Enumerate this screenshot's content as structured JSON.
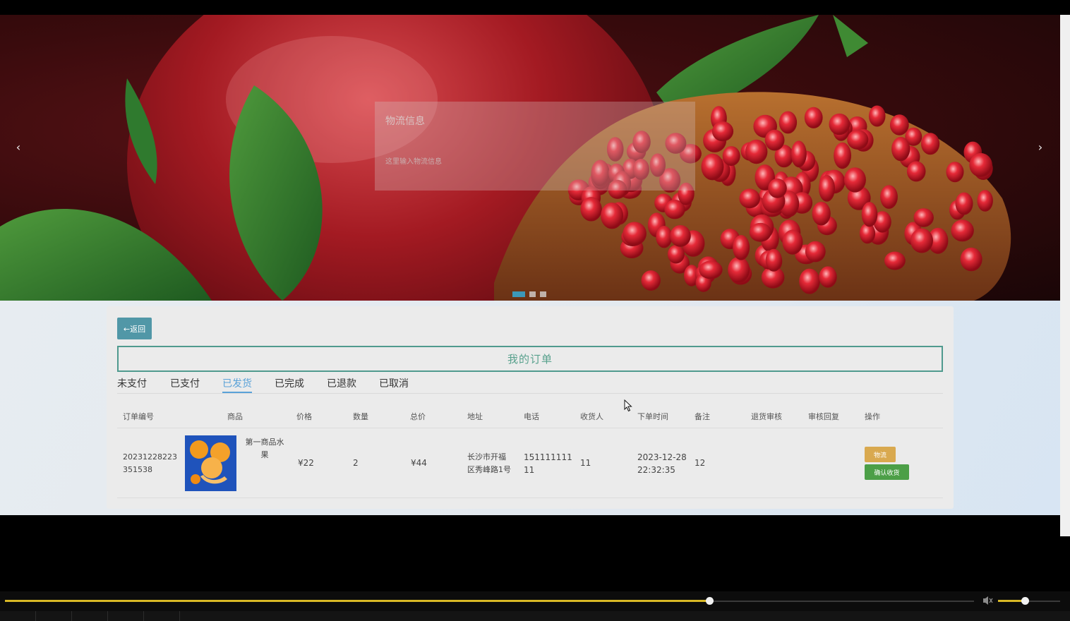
{
  "banner": {
    "prev_arrow": "‹",
    "next_arrow": "›",
    "slides": 3,
    "active_slide": 1,
    "logistics_title": "物流信息",
    "logistics_placeholder": "这里输入物流信息"
  },
  "main": {
    "back_label": "←返回",
    "page_title": "我的订单",
    "tabs": [
      {
        "label": "未支付"
      },
      {
        "label": "已支付"
      },
      {
        "label": "已发货"
      },
      {
        "label": "已完成"
      },
      {
        "label": "已退款"
      },
      {
        "label": "已取消"
      }
    ],
    "active_tab": "已发货",
    "columns": [
      "订单编号",
      "商品",
      "价格",
      "数量",
      "总价",
      "地址",
      "电话",
      "收货人",
      "下单时间",
      "备注",
      "退货审核",
      "审核回复",
      "操作"
    ],
    "orders": [
      {
        "order_no_line1": "20231228223",
        "order_no_line2": "351538",
        "product_line1": "第一商品水",
        "product_line2": "果",
        "price": "¥22",
        "quantity": "2",
        "total": "¥44",
        "address_line1": "长沙市开福",
        "address_line2": "区秀峰路1号",
        "phone_line1": "151111111",
        "phone_line2": "11",
        "receiver": "11",
        "time_line1": "2023-12-28",
        "time_line2": "22:32:35",
        "remark": "12",
        "return_review": "",
        "review_reply": "",
        "logistics_label": "物流",
        "confirm_label": "确认收货"
      }
    ]
  },
  "player": {
    "progress": 0.727,
    "volume": 0.44
  },
  "colors": {
    "accent": "#5197a7",
    "title_border": "#4f9a8e",
    "active_tab": "#5aa2d8",
    "logistics_btn": "#d9a94f",
    "confirm_btn": "#4c9f47",
    "progress": "#d8b826"
  }
}
